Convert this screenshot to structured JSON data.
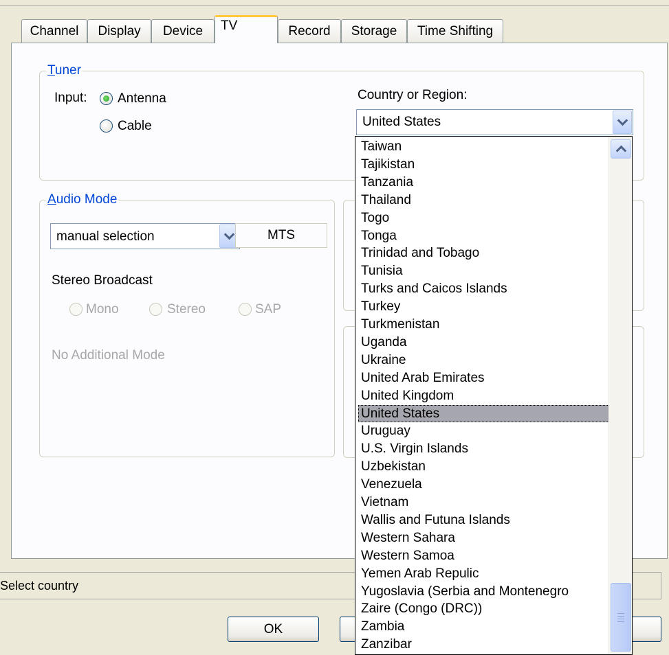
{
  "tabs": [
    "Channel",
    "Display",
    "Device",
    "TV",
    "Record",
    "Storage",
    "Time Shifting"
  ],
  "tuner": {
    "legend_first": "T",
    "legend_rest": "uner",
    "input_label": "Input:",
    "antenna_label": "Antenna",
    "cable_label": "Cable",
    "country_label": "Country or Region:",
    "country_value": "United States"
  },
  "audio": {
    "legend_first": "A",
    "legend_rest": "udio Mode",
    "mode_value": "manual selection",
    "mts_label": "MTS",
    "stereo_broadcast": "Stereo Broadcast",
    "mono": "Mono",
    "stereo": "Stereo",
    "sap": "SAP",
    "no_additional": "No Additional Mode"
  },
  "status_text": "Select country",
  "buttons": {
    "ok": "OK"
  },
  "country_list": {
    "selected": "United States",
    "items": [
      "Taiwan",
      "Tajikistan",
      "Tanzania",
      "Thailand",
      "Togo",
      "Tonga",
      "Trinidad and Tobago",
      "Tunisia",
      "Turks and Caicos Islands",
      "Turkey",
      "Turkmenistan",
      "Uganda",
      "Ukraine",
      "United Arab Emirates",
      "United Kingdom",
      "United States",
      "Uruguay",
      "U.S. Virgin Islands",
      "Uzbekistan",
      "Venezuela",
      "Vietnam",
      "Wallis and Futuna Islands",
      "Western Sahara",
      "Western Samoa",
      "Yemen Arab Repulic",
      "Yugoslavia (Serbia and Montenegro",
      "Zaire (Congo (DRC))",
      "Zambia",
      "Zanzibar"
    ]
  },
  "icons": {
    "dropdown_arrow": "chevron-down-icon",
    "scroll_up": "chevron-up-icon",
    "thumb_grip": "grip-icon"
  }
}
